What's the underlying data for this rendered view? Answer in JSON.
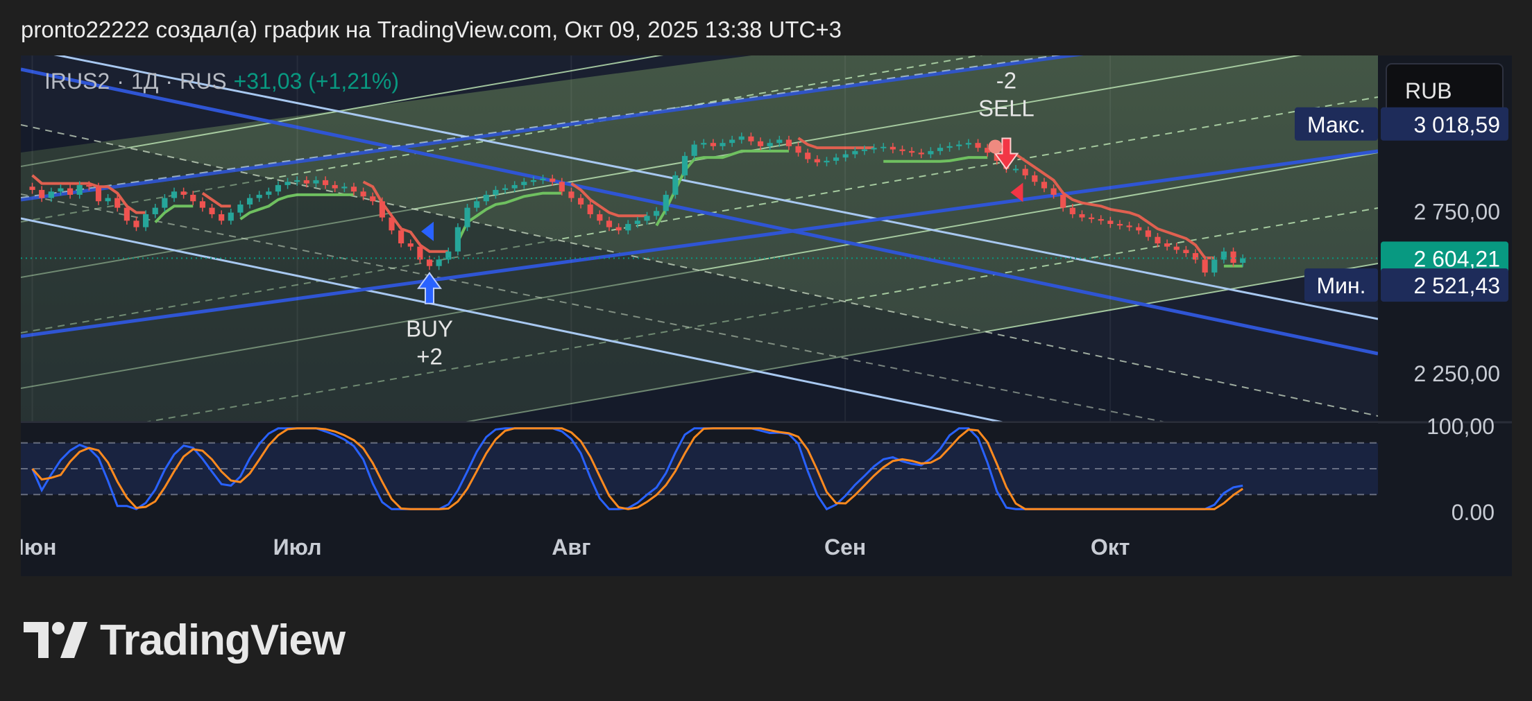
{
  "header": {
    "text": "pronto22222 создал(а) график на TradingView.com, Окт 09, 2025 13:38 UTC+3"
  },
  "brand": {
    "name": "TradingView",
    "logo_icon": "tradingview-logo-icon"
  },
  "colors": {
    "background": "#1f1f1f",
    "chart_bg": "#151922",
    "up_candle": "#26a69a",
    "down_candle": "#ef5350",
    "blue_line": "#2f55d4",
    "light_blue_line": "#a8c8f0",
    "green_channel": "#b8e0b0",
    "supertrend_up": "#6fc060",
    "supertrend_down": "#e06050",
    "stoch_k": "#2962ff",
    "stoch_d": "#ff8a1e",
    "current_price": "#089981",
    "axis_label_bg": "#1e2c5a"
  },
  "chart_data": {
    "type": "candlestick",
    "symbol_legend": {
      "symbol": "IRUS2",
      "sep1": "·",
      "interval": "1Д",
      "sep2": "·",
      "exchange": "RUS",
      "change": "+31,03 (+1,21%)"
    },
    "currency_button": "RUB",
    "price_axis": {
      "range": [
        2100,
        3230
      ],
      "ticks": [
        {
          "value": 2750,
          "label": "2 750,00"
        },
        {
          "value": 2250,
          "label": "2 250,00"
        }
      ]
    },
    "max_label": {
      "caption": "Макс.",
      "value": 3018.59,
      "label": "3 018,59"
    },
    "min_label": {
      "caption": "Мин.",
      "value": 2521.43,
      "label": "2 521,43"
    },
    "current_price": {
      "value": 2604.21,
      "label": "2 604,21"
    },
    "x_axis": {
      "labels": [
        {
          "day": 0,
          "label": "Июн"
        },
        {
          "day": 30,
          "label": "Июл"
        },
        {
          "day": 61,
          "label": "Авг"
        },
        {
          "day": 92,
          "label": "Сен"
        },
        {
          "day": 122,
          "label": "Окт"
        }
      ],
      "visible_days": [
        -1.3,
        152.3
      ]
    },
    "candles_close": [
      2815,
      2790,
      2810,
      2820,
      2800,
      2830,
      2825,
      2780,
      2790,
      2760,
      2720,
      2700,
      2740,
      2760,
      2790,
      2810,
      2800,
      2780,
      2760,
      2740,
      2720,
      2745,
      2770,
      2790,
      2800,
      2810,
      2830,
      2840,
      2845,
      2835,
      2845,
      2830,
      2820,
      2825,
      2810,
      2795,
      2780,
      2730,
      2690,
      2650,
      2640,
      2600,
      2580,
      2600,
      2625,
      2700,
      2760,
      2780,
      2800,
      2815,
      2820,
      2830,
      2840,
      2845,
      2850,
      2840,
      2810,
      2790,
      2770,
      2740,
      2720,
      2700,
      2690,
      2710,
      2720,
      2735,
      2750,
      2800,
      2860,
      2920,
      2955,
      2960,
      2950,
      2960,
      2970,
      2980,
      2965,
      2950,
      2960,
      2970,
      2950,
      2930,
      2910,
      2900,
      2905,
      2915,
      2925,
      2935,
      2940,
      2945,
      2948,
      2940,
      2935,
      2930,
      2925,
      2935,
      2945,
      2950,
      2955,
      2960,
      2945,
      2930,
      2905,
      2880,
      2880,
      2860,
      2840,
      2820,
      2800,
      2760,
      2740,
      2730,
      2725,
      2720,
      2710,
      2705,
      2700,
      2690,
      2670,
      2650,
      2640,
      2630,
      2620,
      2600,
      2560,
      2600,
      2625,
      2590,
      2604
    ],
    "signals": [
      {
        "type": "BUY",
        "label": "BUY",
        "qty": "+2",
        "day": 42
      },
      {
        "type": "SELL",
        "label": "SELL",
        "qty": "-2",
        "day": 103
      }
    ],
    "oscillator": {
      "name": "Stochastic",
      "range": [
        0,
        100
      ],
      "ticks": [
        {
          "value": 100,
          "label": "100,00"
        },
        {
          "value": 0,
          "label": "0.00"
        }
      ],
      "bands": [
        80,
        50,
        20
      ]
    }
  }
}
